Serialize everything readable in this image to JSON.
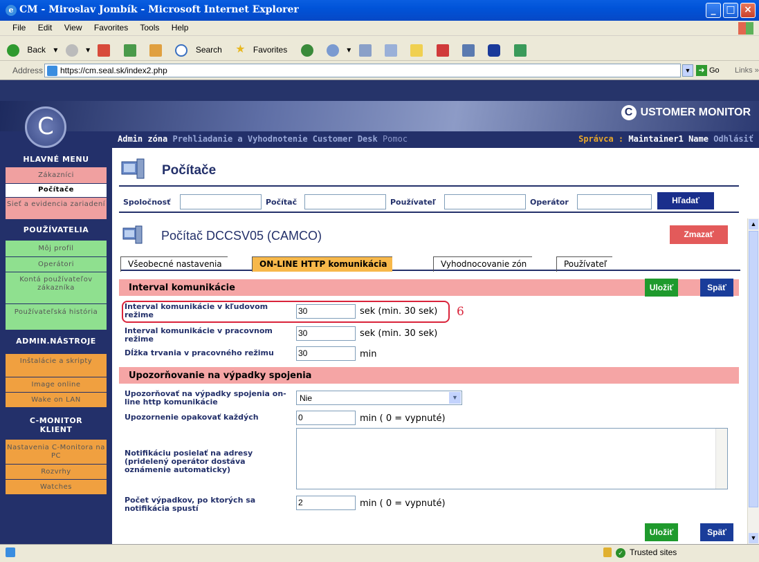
{
  "window": {
    "title": "CM - Miroslav Jombík - Microsoft Internet Explorer"
  },
  "menubar": {
    "items": [
      "File",
      "Edit",
      "View",
      "Favorites",
      "Tools",
      "Help"
    ]
  },
  "toolbar": {
    "back": "Back",
    "search": "Search",
    "favorites": "Favorites"
  },
  "address": {
    "label": "Address",
    "url": "https://cm.seal.sk/index2.php",
    "go": "Go",
    "links": "Links"
  },
  "brand": {
    "text": "USTOMER MONITOR",
    "mark": "C"
  },
  "nav": {
    "items": [
      "Admin zóna",
      "Prehliadanie a Vyhodnotenie",
      "Customer Desk",
      "Pomoc"
    ],
    "role_label": "Správca :",
    "user": "Maintainer1 Name",
    "logout": "Odhlásiť"
  },
  "sidebar": {
    "heading_main": "HLAVNÉ MENU",
    "main_items": [
      "Zákazníci",
      "Počítače",
      "Sieť a evidencia zariadení"
    ],
    "heading_users": "POUŽÍVATELIA",
    "user_items": [
      "Môj profil",
      "Operátori",
      "Kontá používateľov zákazníka",
      "Používateľská história"
    ],
    "heading_tools": "ADMIN.NÁSTROJE",
    "tool_items": [
      "Inštalácie a skripty",
      "Image online",
      "Wake on LAN"
    ],
    "heading_client": "C-MONITOR KLIENT",
    "client_items": [
      "Nastavenia C-Monitora na PC",
      "Rozvrhy",
      "Watches"
    ]
  },
  "page": {
    "title": "Počítače"
  },
  "search": {
    "company_label": "Spoločnosť",
    "computer_label": "Počítač",
    "user_label": "Používateľ",
    "operator_label": "Operátor",
    "button": "Hľadať"
  },
  "computer": {
    "title": "Počítač DCCSV05 (CAMCO)",
    "delete": "Zmazať"
  },
  "tabs": [
    "Všeobecné nastavenia",
    "ON-LINE HTTP komunikácia",
    "Vyhodnocovanie zón",
    "Používateľ"
  ],
  "section1": {
    "title": "Interval komunikácie",
    "save": "Uložiť",
    "back": "Späť",
    "fields": [
      {
        "label": "Interval komunikácie v kľudovom režime",
        "value": "30",
        "note": "sek (min. 30 sek)"
      },
      {
        "label": "Interval komunikácie v pracovnom režime",
        "value": "30",
        "note": "sek (min. 30 sek)"
      },
      {
        "label": "Dĺžka trvania v pracovného režimu",
        "value": "30",
        "note": "min"
      }
    ],
    "marker": "6"
  },
  "section2": {
    "title": "Upozorňovanie na výpadky spojenia",
    "notify_label": "Upozorňovať na výpadky spojenia on-line http komunikácie",
    "notify_value": "Nie",
    "repeat_label": "Upozornenie opakovať každých",
    "repeat_value": "0",
    "repeat_note": "min ( 0 = vypnuté)",
    "emails_label": "Notifikáciu posielať na adresy (pridelený operátor dostáva oznámenie automaticky)",
    "count_label": "Počet výpadkov, po ktorých sa notifikácia spustí",
    "count_value": "2",
    "count_note": "min ( 0 = vypnuté)",
    "save": "Uložiť",
    "back": "Späť"
  },
  "status": {
    "zone": "Trusted sites"
  },
  "colors": {
    "navy": "#23306a",
    "pink_section": "#f5a5a5",
    "save_green": "#1f9a2d",
    "back_blue": "#1a3d9a",
    "delete_red": "#e35a5a",
    "highlight": "#d9233a"
  }
}
